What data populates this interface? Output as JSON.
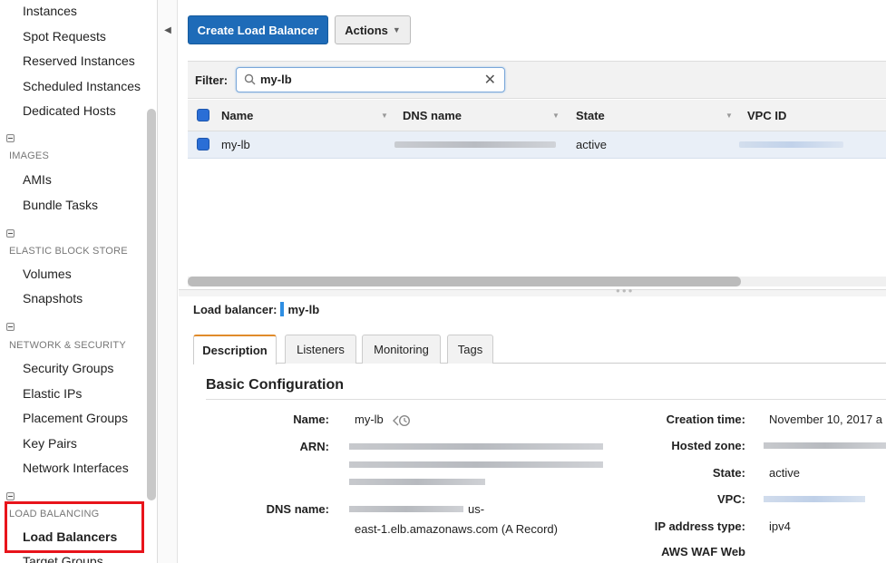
{
  "sidebar": {
    "instances_group": [
      "Instances",
      "Spot Requests",
      "Reserved Instances",
      "Scheduled Instances",
      "Dedicated Hosts"
    ],
    "images": {
      "header": "IMAGES",
      "items": [
        "AMIs",
        "Bundle Tasks"
      ]
    },
    "ebs": {
      "header": "ELASTIC BLOCK STORE",
      "items": [
        "Volumes",
        "Snapshots"
      ]
    },
    "network": {
      "header": "NETWORK & SECURITY",
      "items": [
        "Security Groups",
        "Elastic IPs",
        "Placement Groups",
        "Key Pairs",
        "Network Interfaces"
      ]
    },
    "lb": {
      "header": "LOAD BALANCING",
      "items": [
        "Load Balancers",
        "Target Groups"
      ],
      "active": "Load Balancers"
    }
  },
  "toolbar": {
    "create_label": "Create Load Balancer",
    "actions_label": "Actions"
  },
  "filter": {
    "label": "Filter:",
    "value": "my-lb"
  },
  "grid": {
    "columns": [
      "Name",
      "DNS name",
      "State",
      "VPC ID"
    ],
    "rows": [
      {
        "name": "my-lb",
        "state": "active"
      }
    ]
  },
  "details": {
    "lb_label": "Load balancer:",
    "lb_name": "my-lb",
    "tabs": [
      "Description",
      "Listeners",
      "Monitoring",
      "Tags"
    ],
    "active_tab": "Description",
    "section_title": "Basic Configuration",
    "left": {
      "name_label": "Name:",
      "name_value": "my-lb",
      "arn_label": "ARN:",
      "dns_label": "DNS name:",
      "dns_tail": "us-",
      "dns_line2": "east-1.elb.amazonaws.com (A Record)"
    },
    "right": {
      "creation_label": "Creation time:",
      "creation_value": "November 10, 2017 a",
      "hosted_label": "Hosted zone:",
      "state_label": "State:",
      "state_value": "active",
      "vpc_label": "VPC:",
      "ip_label": "IP address type:",
      "ip_value": "ipv4",
      "waf_label": "AWS WAF Web"
    }
  },
  "colors": {
    "primary_button": "#1e6bb8",
    "highlight_box": "#e8141b",
    "checkbox": "#2a6ed6",
    "active_tab_accent": "#e08b2b"
  }
}
